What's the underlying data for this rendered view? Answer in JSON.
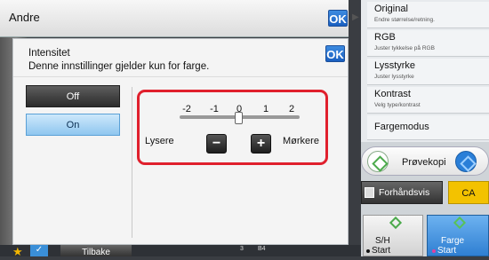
{
  "header": {
    "title": "Andre",
    "ok_label": "OK"
  },
  "dialog": {
    "ok_label": "OK",
    "title": "Intensitet",
    "note": "Denne innstillinger gjelder kun for farge.",
    "options": [
      {
        "label": "Off",
        "selected": false
      },
      {
        "label": "On",
        "selected": true
      }
    ],
    "slider": {
      "ticks": [
        "-2",
        "-1",
        "0",
        "1",
        "2"
      ],
      "value": 0,
      "left_label": "Lysere",
      "right_label": "Mørkere"
    }
  },
  "menu": [
    {
      "label": "Original",
      "sub": "Endre størrelse/retning."
    },
    {
      "label": "RGB",
      "sub": "Juster tykkelse på RGB"
    },
    {
      "label": "Lysstyrke",
      "sub": "Juster lysstyrke"
    },
    {
      "label": "Kontrast",
      "sub": "Velg type/kontrast"
    },
    {
      "label": "Fargemodus",
      "sub": ""
    }
  ],
  "actions": {
    "proof_label": "Prøvekopi",
    "preview_label": "Forhåndsvis",
    "ca_label": "CA",
    "start_bw_line1": "S/H",
    "start_bw_line2": "Start",
    "start_color_line1": "Farge",
    "start_color_line2": "Start"
  },
  "bottom": {
    "back_label": "Tilbake",
    "info1": "3",
    "info2": "B4"
  },
  "colors": {
    "accent_blue": "#2a7fd8",
    "highlight_red": "#e0202d",
    "ca_yellow": "#f3c200"
  }
}
